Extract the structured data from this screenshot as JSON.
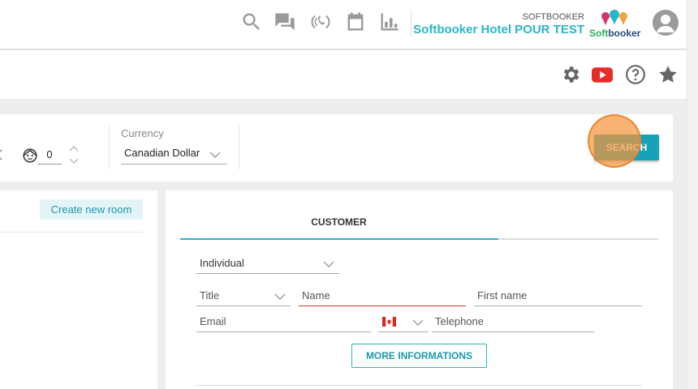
{
  "topbar": {
    "icons": [
      "search-icon",
      "chat-icon",
      "phone-ring-icon",
      "calendar-icon",
      "bar-chart-icon"
    ],
    "hotel_company": "SOFTBOOKER",
    "hotel_name": "Softbooker Hotel POUR TEST",
    "logo_text_soft": "Soft",
    "logo_text_booker": "booker"
  },
  "subbar": {
    "icons": [
      "gear-icon",
      "youtube-icon",
      "help-icon",
      "star-icon"
    ]
  },
  "search": {
    "children_count": "0",
    "currency_label": "Currency",
    "currency_value": "Canadian Dollar",
    "search_label": "SEARCH"
  },
  "rooms": {
    "create_label": "Create new room"
  },
  "customer": {
    "tab_label": "CUSTOMER",
    "type_value": "Individual",
    "title_placeholder": "Title",
    "name_placeholder": "Name",
    "firstname_placeholder": "First name",
    "email_placeholder": "Email",
    "telephone_placeholder": "Telephone",
    "more_label": "MORE INFORMATIONS"
  },
  "colors": {
    "accent": "#2ab5c8",
    "search_button": "#17a2b8",
    "youtube": "#e52d27",
    "error_underline": "#c0392b"
  }
}
